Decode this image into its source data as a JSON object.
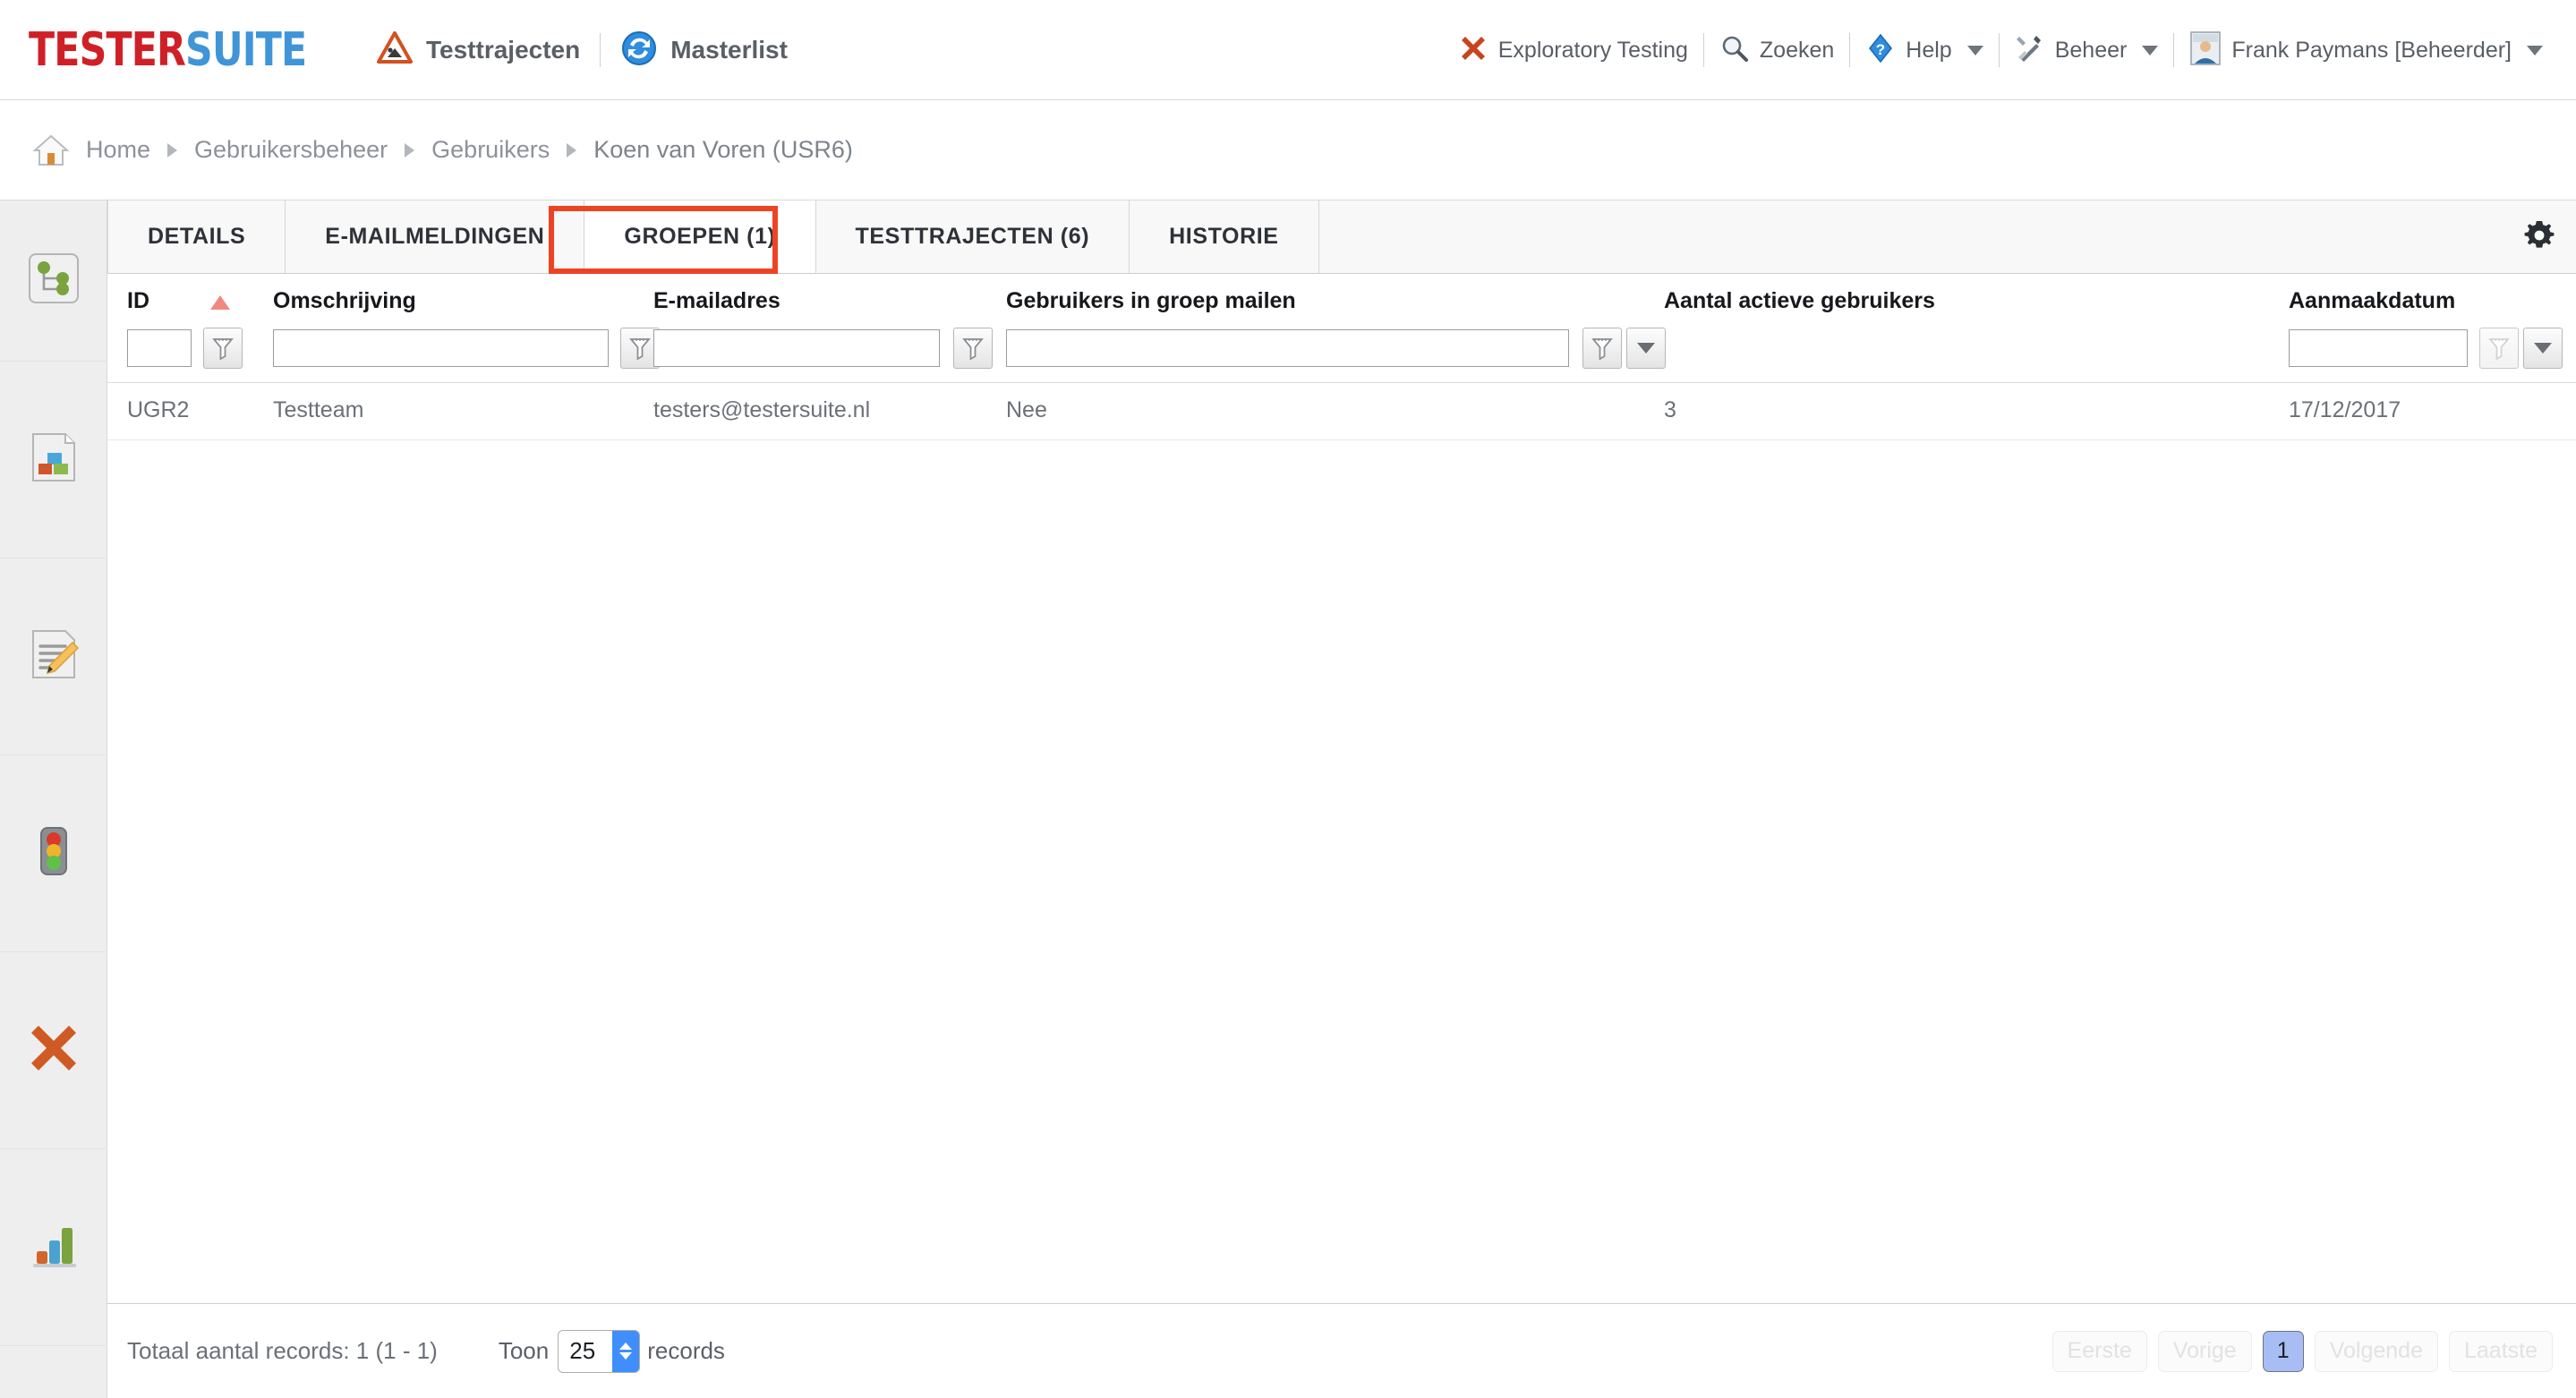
{
  "brand": {
    "part1": "TESTER",
    "part2": "SUITE",
    "color1": "#cf2027",
    "color2": "#3f95d7"
  },
  "header": {
    "nav": [
      {
        "label": "Testtrajecten",
        "icon": "roadworks-sign-icon"
      },
      {
        "label": "Masterlist",
        "icon": "globe-refresh-icon"
      }
    ],
    "right": [
      {
        "label": "Exploratory Testing",
        "icon": "red-x-icon",
        "caret": false
      },
      {
        "label": "Zoeken",
        "icon": "search-icon",
        "caret": false
      },
      {
        "label": "Help",
        "icon": "help-diamond-icon",
        "caret": true
      },
      {
        "label": "Beheer",
        "icon": "tools-icon",
        "caret": true
      },
      {
        "label": "Frank Paymans [Beheerder]",
        "icon": "avatar-icon",
        "caret": true
      }
    ]
  },
  "breadcrumb": {
    "home_icon": "home-icon",
    "items": [
      "Home",
      "Gebruikersbeheer",
      "Gebruikers",
      "Koen van Voren (USR6)"
    ]
  },
  "sidebar": {
    "items": [
      {
        "icon": "hierarchy-tree-icon"
      },
      {
        "icon": "document-blocks-icon"
      },
      {
        "icon": "document-edit-icon"
      },
      {
        "icon": "traffic-light-icon"
      },
      {
        "icon": "orange-x-icon"
      },
      {
        "icon": "bar-chart-icon"
      }
    ]
  },
  "tabs": [
    {
      "label": "DETAILS",
      "active": false
    },
    {
      "label": "E-MAILMELDINGEN",
      "active": false
    },
    {
      "label": "GROEPEN (1)",
      "active": true
    },
    {
      "label": "TESTTRAJECTEN (6)",
      "active": false
    },
    {
      "label": "HISTORIE",
      "active": false
    }
  ],
  "annotation": {
    "color": "#ee4323",
    "target": "GROEPEN (1)"
  },
  "gear_icon": "gear-icon",
  "table": {
    "columns": [
      {
        "label": "ID",
        "sorted": "asc"
      },
      {
        "label": "Omschrijving"
      },
      {
        "label": "E-mailadres"
      },
      {
        "label": "Gebruikers in groep mailen"
      },
      {
        "label": "Aantal actieve gebruikers"
      },
      {
        "label": "Aanmaakdatum"
      }
    ],
    "filters": {
      "id": "",
      "omschrijving": "",
      "email": "",
      "mailen": "",
      "aanmaakdatum": ""
    },
    "rows": [
      {
        "id": "UGR2",
        "omschrijving": "Testteam",
        "email": "testers@testersuite.nl",
        "mailen": "Nee",
        "actieve_gebruikers": "3",
        "aanmaakdatum": "17/12/2017"
      }
    ]
  },
  "footer": {
    "total_text": "Totaal aantal records: 1 (1 - 1)",
    "toon_label": "Toon",
    "page_size": "25",
    "records_label": "records",
    "pager": [
      {
        "label": "Eerste",
        "enabled": false
      },
      {
        "label": "Vorige",
        "enabled": false
      },
      {
        "label": "1",
        "enabled": true,
        "current": true
      },
      {
        "label": "Volgende",
        "enabled": false
      },
      {
        "label": "Laatste",
        "enabled": false
      }
    ]
  }
}
